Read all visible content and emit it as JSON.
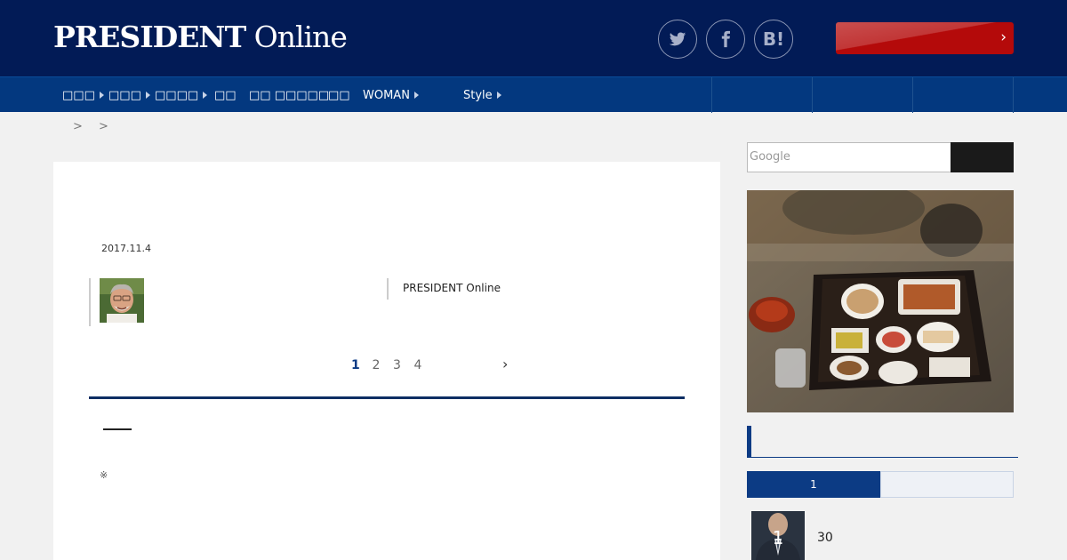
{
  "header": {
    "logo_bold": "PRESIDENT",
    "logo_light": " Online",
    "social": [
      {
        "icon": "twitter-icon"
      },
      {
        "icon": "facebook-icon"
      },
      {
        "icon": "hatena-bookmark-icon",
        "label": "B!"
      }
    ],
    "cta_chevron": "›"
  },
  "nav": {
    "items": [
      "□□□",
      "□□□",
      "□□□□",
      "□□",
      "□□ □□□□□",
      "□□",
      "WOMAN",
      "Style"
    ]
  },
  "breadcrumb": {
    "sep1": ">",
    "sep2": ">"
  },
  "article": {
    "date": "2017.11.4",
    "source": "PRESIDENT Online",
    "pages": [
      "1",
      "2",
      "3",
      "4"
    ],
    "next": "›",
    "note": "※"
  },
  "sidebar": {
    "search_placeholder": "Google",
    "ranking_tab_1": "1",
    "rank_number": "1",
    "rank_text": "30"
  },
  "colors": {
    "header_bg": "#021b56",
    "nav_bg": "#03387f",
    "accent_blue": "#0c3b84",
    "cta_red": "#b40a0a"
  }
}
